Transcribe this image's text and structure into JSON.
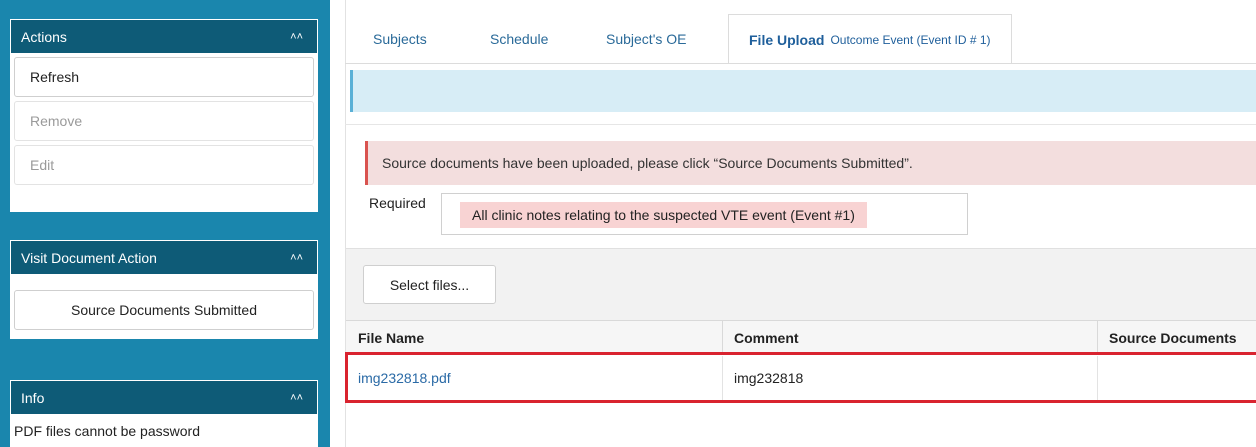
{
  "sidebar": {
    "actions": {
      "title": "Actions",
      "buttons": [
        {
          "label": "Refresh",
          "enabled": true
        },
        {
          "label": "Remove",
          "enabled": false
        },
        {
          "label": "Edit",
          "enabled": false
        }
      ]
    },
    "visit_document": {
      "title": "Visit Document Action",
      "button_label": "Source Documents Submitted"
    },
    "info": {
      "title": "Info",
      "text": "PDF files cannot be password"
    }
  },
  "tabs": [
    {
      "label": "Subjects"
    },
    {
      "label": "Schedule"
    },
    {
      "label": "Subject's OE"
    },
    {
      "label": "File Upload",
      "sublabel": "Outcome Event (Event ID # 1)",
      "active": true
    }
  ],
  "alert": {
    "text": "Source documents have been uploaded, please click “Source Documents Submitted”."
  },
  "required": {
    "label": "Required",
    "item": "All clinic notes relating to the suspected VTE event (Event #1)"
  },
  "upload": {
    "select_label": "Select files..."
  },
  "grid": {
    "columns": [
      "File Name",
      "Comment",
      "Source Documents"
    ],
    "rows": [
      {
        "file_name": "img232818.pdf",
        "comment": "img232818",
        "source": ""
      }
    ]
  },
  "colors": {
    "sidebar_bg": "#1a86ad",
    "panel_header_bg": "#0e5b77",
    "link": "#2a6aa6",
    "alert_bg": "#f3dede",
    "highlight": "#d9232f"
  },
  "icons": {
    "panel_toggle": "double-chevron-up-icon"
  }
}
